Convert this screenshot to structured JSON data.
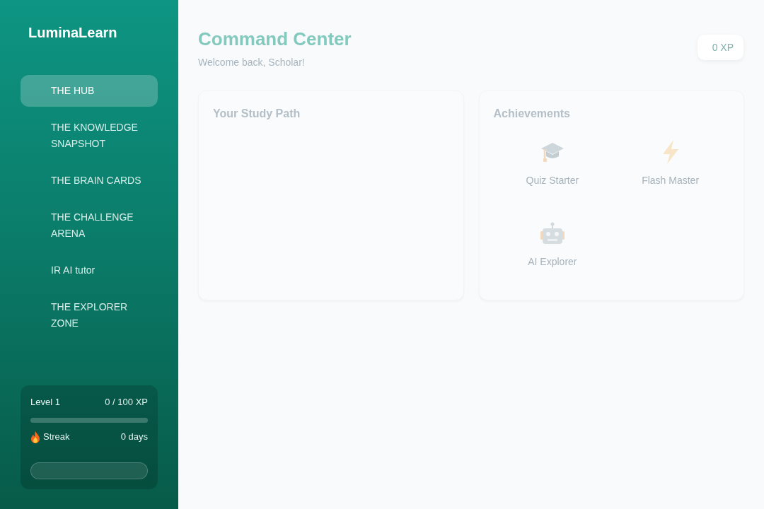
{
  "sidebar": {
    "logo": "LuminaLearn",
    "items": [
      {
        "label": "THE HUB",
        "selected": true
      },
      {
        "label": "THE KNOWLEDGE SNAPSHOT",
        "selected": false
      },
      {
        "label": "THE BRAIN CARDS",
        "selected": false
      },
      {
        "label": "THE CHALLENGE ARENA",
        "selected": false
      },
      {
        "label": "IR AI tutor",
        "selected": false
      },
      {
        "label": "THE EXPLORER ZONE",
        "selected": false
      }
    ],
    "stats": {
      "level_label": "Level 1",
      "xp": "0 / 100 XP",
      "level": 0,
      "streak_label": "Streak",
      "streak_value": "0 days"
    }
  },
  "header": {
    "title": "Command Center",
    "subtitle": "Welcome back, Scholar!",
    "xp_badge": "0 XP"
  },
  "study_path": {
    "title": "Your Study Path"
  },
  "achievements": {
    "title": "Achievements",
    "items": [
      {
        "label": "Quiz Starter",
        "kind": "cap"
      },
      {
        "label": "Flash Master",
        "kind": "bolt"
      },
      {
        "label": "AI Explorer",
        "kind": "robot"
      }
    ]
  }
}
